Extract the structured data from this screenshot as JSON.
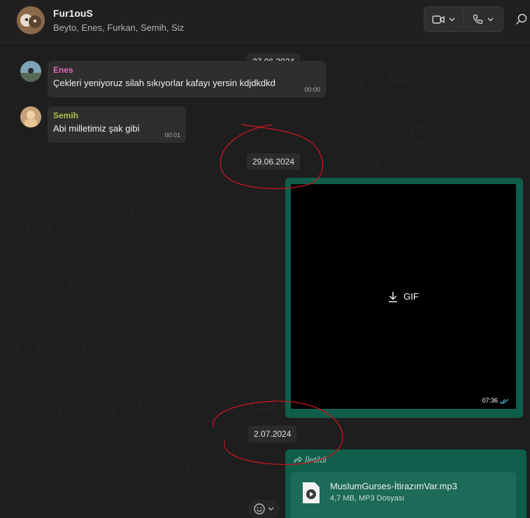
{
  "header": {
    "title": "Fur1ouS",
    "participants": "Beyto, Enes, Furkan, Semih, Siz"
  },
  "messages": [
    {
      "sender": "Enes",
      "sender_color": "#e26ab9",
      "text": "Çekleri yeniyoruz silah sıkıyorlar kafayı yersin kdjdkdkd",
      "time": "00:00"
    },
    {
      "sender": "Semih",
      "sender_color": "#a9c24c",
      "text": "Abi milletimiz şak gibi",
      "time": "00:01"
    }
  ],
  "dates": {
    "first": "27.06.2024",
    "second": "29.06.2024",
    "third": "2.07.2024"
  },
  "gif": {
    "label": "GIF",
    "time": "07:36",
    "tick_color": "#53bdeb"
  },
  "forwarded": {
    "label": "İletildi",
    "file_name": "MuslumGurses-İtirazımVar.mp3",
    "file_meta": "4,7 MB, MP3 Dosyası"
  },
  "colors": {
    "outgoing_bubble": "#0f5e4b",
    "incoming_bubble": "#2e2e2e",
    "annotation": "#c8161d"
  }
}
